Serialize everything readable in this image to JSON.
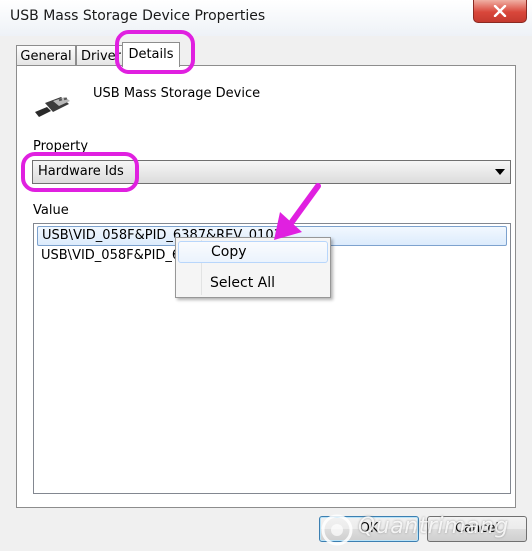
{
  "window": {
    "title": "USB Mass Storage Device Properties"
  },
  "tabs": [
    {
      "label": "General"
    },
    {
      "label": "Driver"
    },
    {
      "label": "Details"
    }
  ],
  "device": {
    "name": "USB Mass Storage Device",
    "icon": "usb-plug-icon"
  },
  "property": {
    "label": "Property",
    "selected": "Hardware Ids"
  },
  "value": {
    "label": "Value",
    "items": [
      "USB\\VID_058F&PID_6387&REV_0103",
      "USB\\VID_058F&PID_6387"
    ]
  },
  "context_menu": {
    "items": [
      "Copy",
      "Select All"
    ]
  },
  "buttons": {
    "ok": "OK",
    "cancel": "Cancel"
  },
  "watermark": {
    "text": "Quantrimang"
  },
  "colors": {
    "annotation": "#e020e0",
    "close": "#d9473b",
    "selection": "#dcebfc"
  }
}
